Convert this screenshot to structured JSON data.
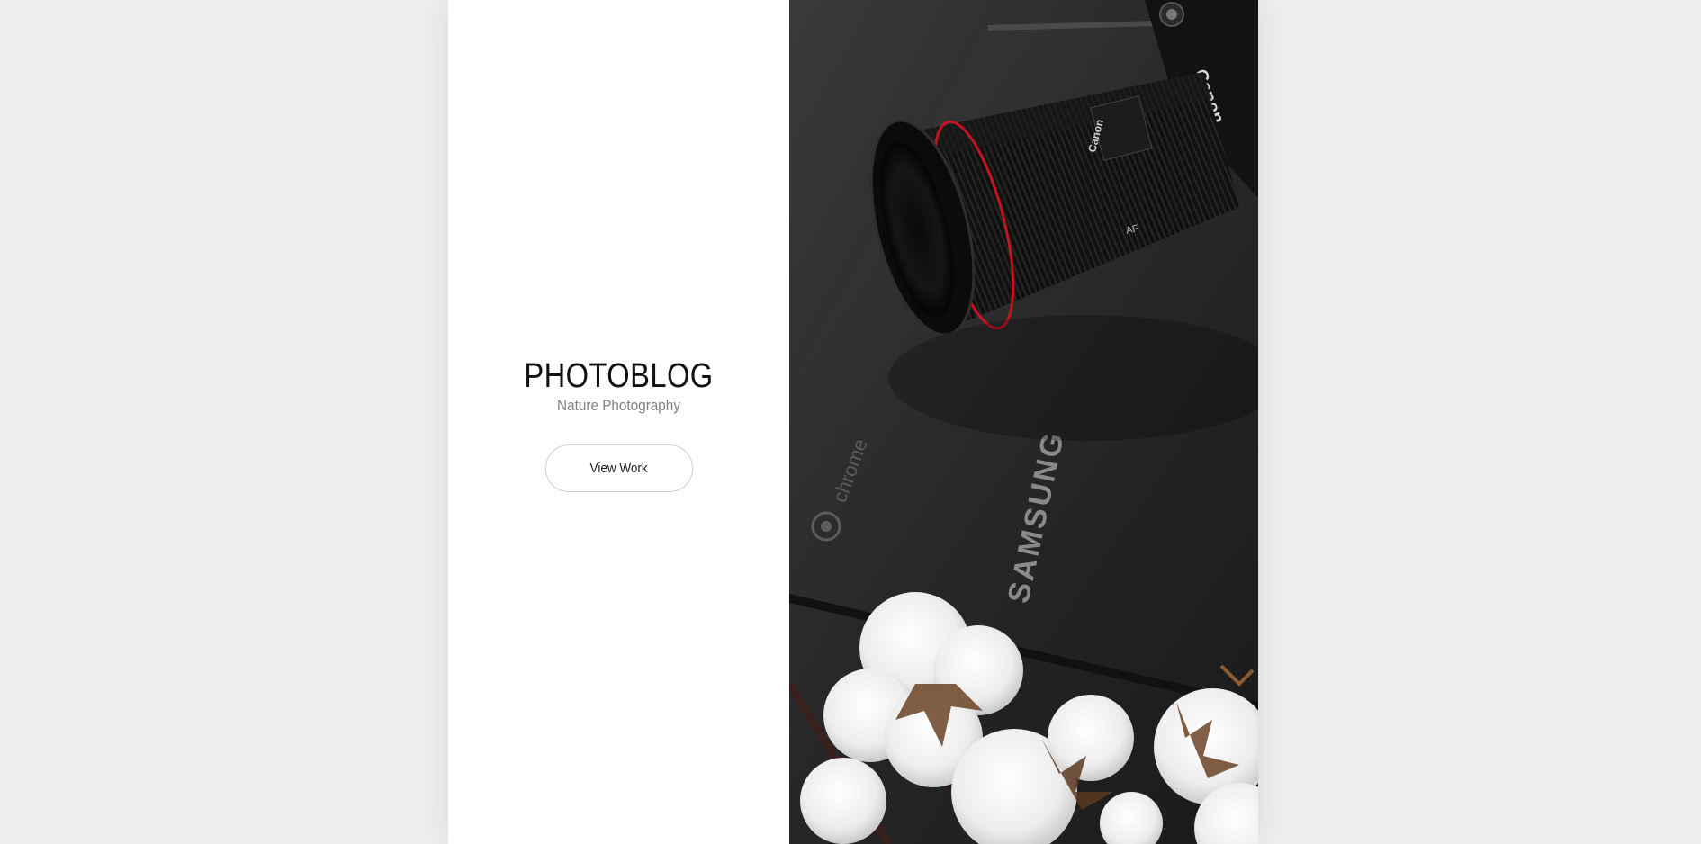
{
  "site": {
    "title": "PHOTOBLOG",
    "subtitle": "Nature Photography",
    "cta_label": "View Work"
  },
  "hero_image": {
    "subject": "camera-lens-laptop-cotton-photo",
    "laptop_brand": "SAMSUNG",
    "laptop_os": "chrome",
    "lens_brand": "Canon",
    "lens_mark": "AF",
    "camera_brand": "Canon"
  },
  "colors": {
    "page_background": "#efefef",
    "panel_background": "#ffffff",
    "title_text": "#111111",
    "subtitle_text": "#808080",
    "button_border": "#cfcfcf"
  }
}
